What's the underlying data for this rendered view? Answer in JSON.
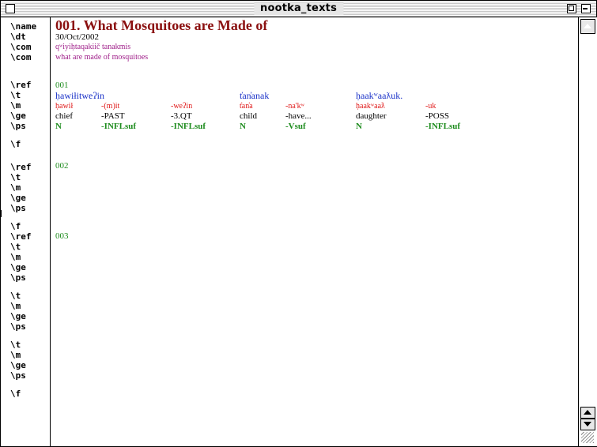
{
  "window": {
    "title": "nootka_texts"
  },
  "markers": [
    "\\name",
    "\\dt",
    "\\com",
    "\\com",
    "\\ref",
    "\\t",
    "\\m",
    "\\ge",
    "\\ps",
    "\\f",
    "\\ref",
    "\\t",
    "\\m",
    "\\ge",
    "\\ps",
    "\\f",
    "\\ref",
    "\\t",
    "\\m",
    "\\ge",
    "\\ps",
    "\\t",
    "\\m",
    "\\ge",
    "\\ps",
    "\\t",
    "\\m",
    "\\ge",
    "\\ps",
    "\\f"
  ],
  "header": {
    "name": "001. What Mosquitoes are Made of",
    "date": "30/Oct/2002",
    "com1": "qʷiyiḥtaqakiič tanakmis",
    "com2": "what are made of  mosquitoes"
  },
  "records": [
    {
      "ref": "001",
      "t": [
        "ḥawiłitweʔin",
        "t̓an̓anak",
        "ḥaakʷaaƛuk."
      ],
      "m": [
        "ḥawił",
        "-(m)it",
        "-weʔin",
        "t̓an̓a",
        "-na'kʷ",
        "ḥaakʷaaƛ",
        "-uk"
      ],
      "ge": [
        "chief",
        "-PAST",
        "-3.QT",
        "child",
        "-have...",
        "daughter",
        "-POSS"
      ],
      "ps": [
        "N",
        "-INFLsuf",
        "-INFLsuf",
        "N",
        "-Vsuf",
        "N",
        "-INFLsuf"
      ]
    },
    {
      "ref": "002"
    },
    {
      "ref": "003"
    }
  ],
  "colors": {
    "title": "#8b1010",
    "ref": "#1e8c1e",
    "text": "#1a32c8",
    "morph": "#e01a1a",
    "comment": "#a0208a",
    "pos": "#1e8c1e"
  }
}
